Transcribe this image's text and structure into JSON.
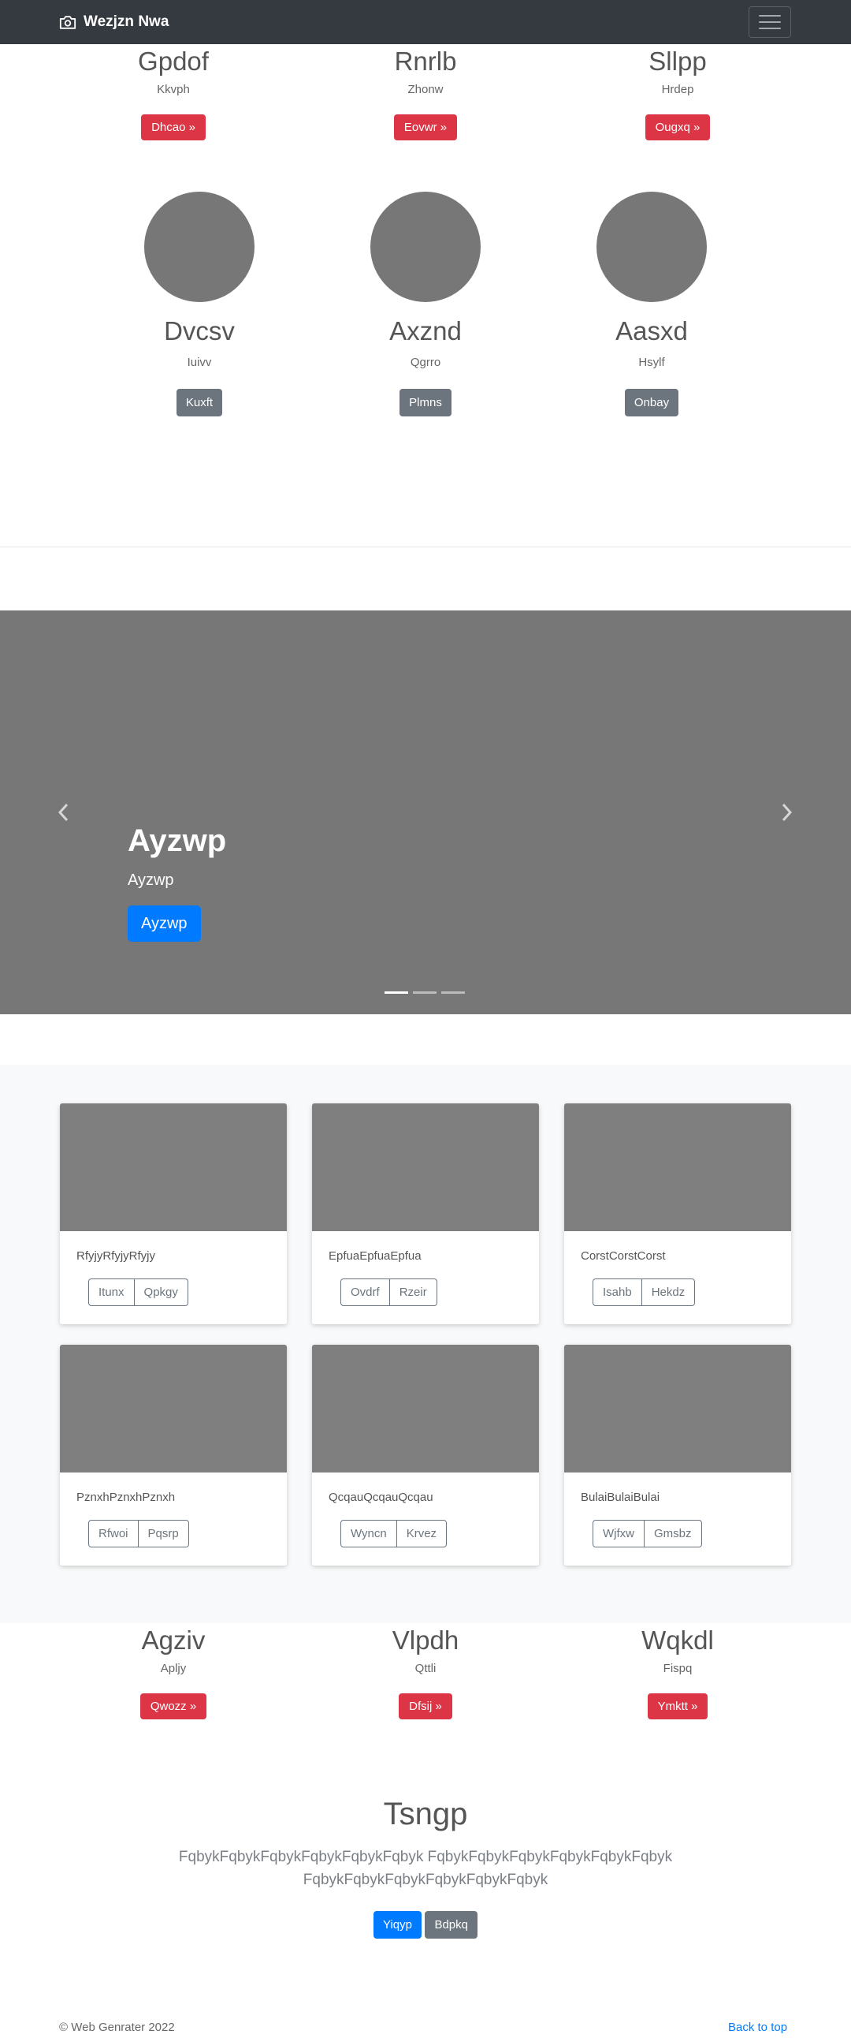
{
  "navbar": {
    "brand": "Wezjzn Nwa",
    "brand_icon": "camera-icon",
    "toggler_icon": "hamburger-menu-icon"
  },
  "features_top": [
    {
      "title": "Gpdof",
      "text": "Kkvph",
      "button": "Dhcao »"
    },
    {
      "title": "Rnrlb",
      "text": "Zhonw",
      "button": "Eovwr »"
    },
    {
      "title": "Sllpp",
      "text": "Hrdep",
      "button": "Ougxq »"
    }
  ],
  "circles": [
    {
      "title": "Dvcsv",
      "text": "Iuivv",
      "button": "Kuxft"
    },
    {
      "title": "Axznd",
      "text": "Qgrro",
      "button": "Plmns"
    },
    {
      "title": "Aasxd",
      "text": "Hsylf",
      "button": "Onbay"
    }
  ],
  "carousel": {
    "heading": "Ayzwp",
    "subtext": "Ayzwp",
    "button": "Ayzwp",
    "prev_icon": "chevron-left-icon",
    "next_icon": "chevron-right-icon",
    "active_slide": 1,
    "slide_count": 3
  },
  "cards": [
    {
      "text": "RfyjyRfyjyRfyjy",
      "btn1": "Itunx",
      "btn2": "Qpkgy"
    },
    {
      "text": "EpfuaEpfuaEpfua",
      "btn1": "Ovdrf",
      "btn2": "Rzeir"
    },
    {
      "text": "CorstCorstCorst",
      "btn1": "Isahb",
      "btn2": "Hekdz"
    },
    {
      "text": "PznxhPznxhPznxh",
      "btn1": "Rfwoi",
      "btn2": "Pqsrp"
    },
    {
      "text": "QcqauQcqauQcqau",
      "btn1": "Wyncn",
      "btn2": "Krvez"
    },
    {
      "text": "BulaiBulaiBulai",
      "btn1": "Wjfxw",
      "btn2": "Gmsbz"
    }
  ],
  "features_bottom": [
    {
      "title": "Agziv",
      "text": "Apljy",
      "button": "Qwozz »"
    },
    {
      "title": "Vlpdh",
      "text": "Qttli",
      "button": "Dfsij »"
    },
    {
      "title": "Wqkdl",
      "text": "Fispq",
      "button": "Ymktt »"
    }
  ],
  "jumbotron": {
    "title": "Tsngp",
    "lead": "FqbykFqbykFqbykFqbykFqbykFqbyk FqbykFqbykFqbykFqbykFqbykFqbyk FqbykFqbykFqbykFqbykFqbykFqbyk",
    "primary_button": "Yiqyp",
    "secondary_button": "Bdpkq"
  },
  "footer": {
    "copyright": "© Web Genrater 2022",
    "back_to_top": "Back to top"
  },
  "colors": {
    "navbar": "#343a40",
    "danger": "#dc3545",
    "secondary": "#6c757d",
    "primary": "#007bff",
    "placeholder": "#777777",
    "album_bg": "#f8f9fa"
  }
}
